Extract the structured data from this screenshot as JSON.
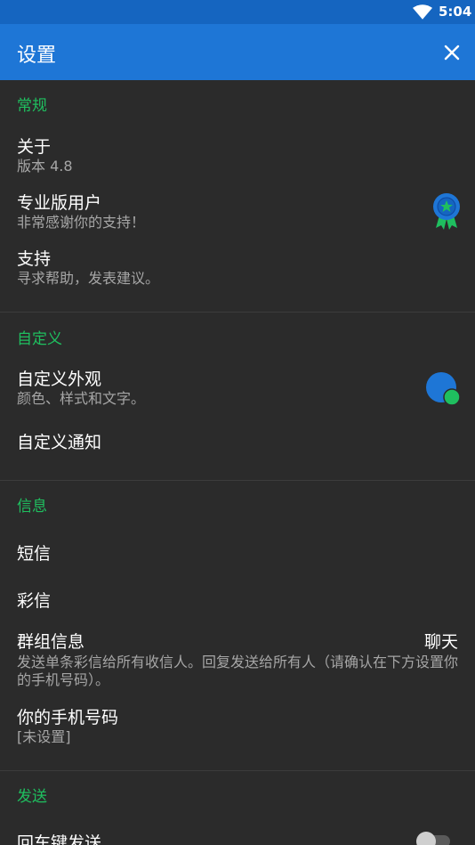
{
  "status_bar": {
    "time": "5:04"
  },
  "app_bar": {
    "title": "设置"
  },
  "sections": {
    "general": {
      "header": "常规",
      "about": {
        "title": "关于",
        "subtitle": "版本 4.8"
      },
      "pro": {
        "title": "专业版用户",
        "subtitle": "非常感谢你的支持！"
      },
      "support": {
        "title": "支持",
        "subtitle": "寻求帮助，发表建议。"
      }
    },
    "customize": {
      "header": "自定义",
      "appearance": {
        "title": "自定义外观",
        "subtitle": "颜色、样式和文字。"
      },
      "notifications": {
        "title": "自定义通知"
      }
    },
    "messages": {
      "header": "信息",
      "sms": {
        "title": "短信"
      },
      "mms": {
        "title": "彩信"
      },
      "group": {
        "title": "群组信息",
        "value": "聊天",
        "subtitle": "发送单条彩信给所有收信人。回复发送给所有人（请确认在下方设置你的手机号码）。"
      },
      "phone_number": {
        "title": "你的手机号码",
        "subtitle": "[未设置]"
      }
    },
    "sending": {
      "header": "发送",
      "enter_to_send": {
        "title": "回车键发送",
        "toggle_on": false
      }
    }
  },
  "colors": {
    "accent_green": "#1fbf5f",
    "app_bar_blue": "#1e76d6",
    "status_bar_blue": "#1565c0",
    "appearance_dot_blue": "#1e76d6",
    "appearance_dot_green": "#1fbf5f"
  }
}
